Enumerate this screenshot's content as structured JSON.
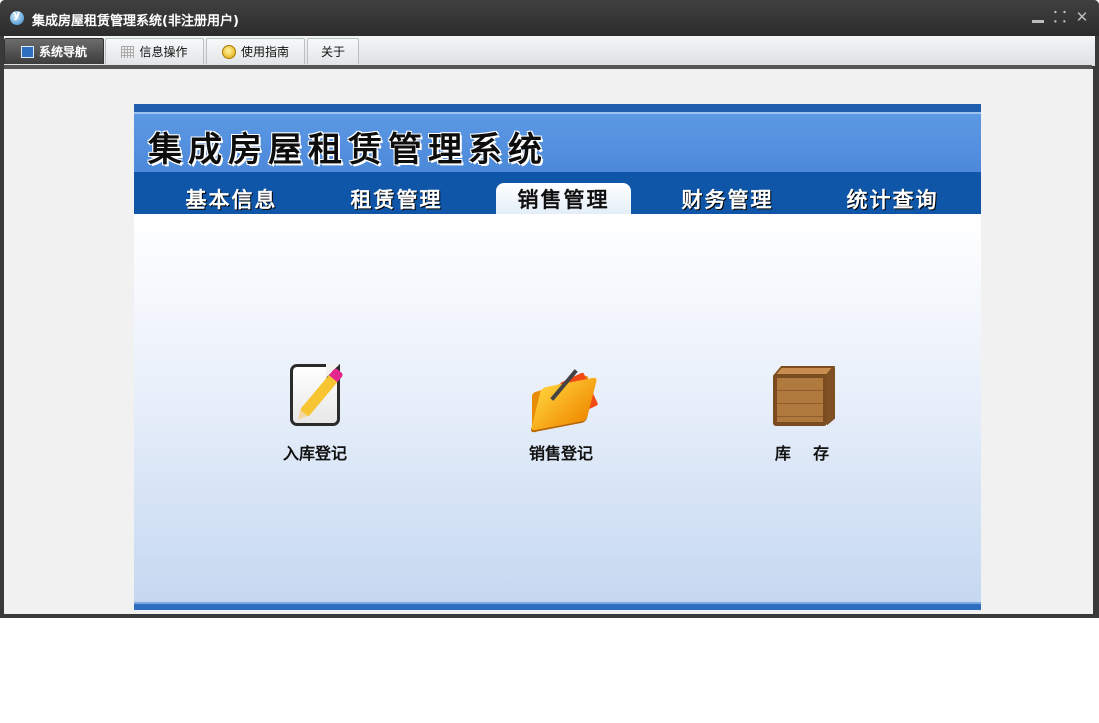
{
  "window": {
    "title": "集成房屋租赁管理系统(非注册用户)",
    "controls": {
      "minimize": "",
      "restore": "⸬",
      "close": "✕"
    }
  },
  "menubar": {
    "tabs": [
      {
        "label": "系统导航",
        "icon": "monitor-icon",
        "active": true
      },
      {
        "label": "信息操作",
        "icon": "grid-icon",
        "active": false
      },
      {
        "label": "使用指南",
        "icon": "guide-icon",
        "active": false
      },
      {
        "label": "关于",
        "icon": "",
        "active": false
      }
    ]
  },
  "panel": {
    "banner_title": "集成房屋租赁管理系统",
    "nav": [
      {
        "label": "基本信息",
        "active": false
      },
      {
        "label": "租赁管理",
        "active": false
      },
      {
        "label": "销售管理",
        "active": true
      },
      {
        "label": "财务管理",
        "active": false
      },
      {
        "label": "统计查询",
        "active": false
      }
    ],
    "functions": [
      {
        "label": "入库登记",
        "icon": "notepad-pencil-icon"
      },
      {
        "label": "销售登记",
        "icon": "folder-pen-icon"
      },
      {
        "label": "库    存",
        "icon": "wooden-crate-icon"
      }
    ]
  },
  "colors": {
    "banner_blue": "#4c88d9",
    "nav_blue": "#0f56a8",
    "window_dark": "#3a3a3a"
  }
}
